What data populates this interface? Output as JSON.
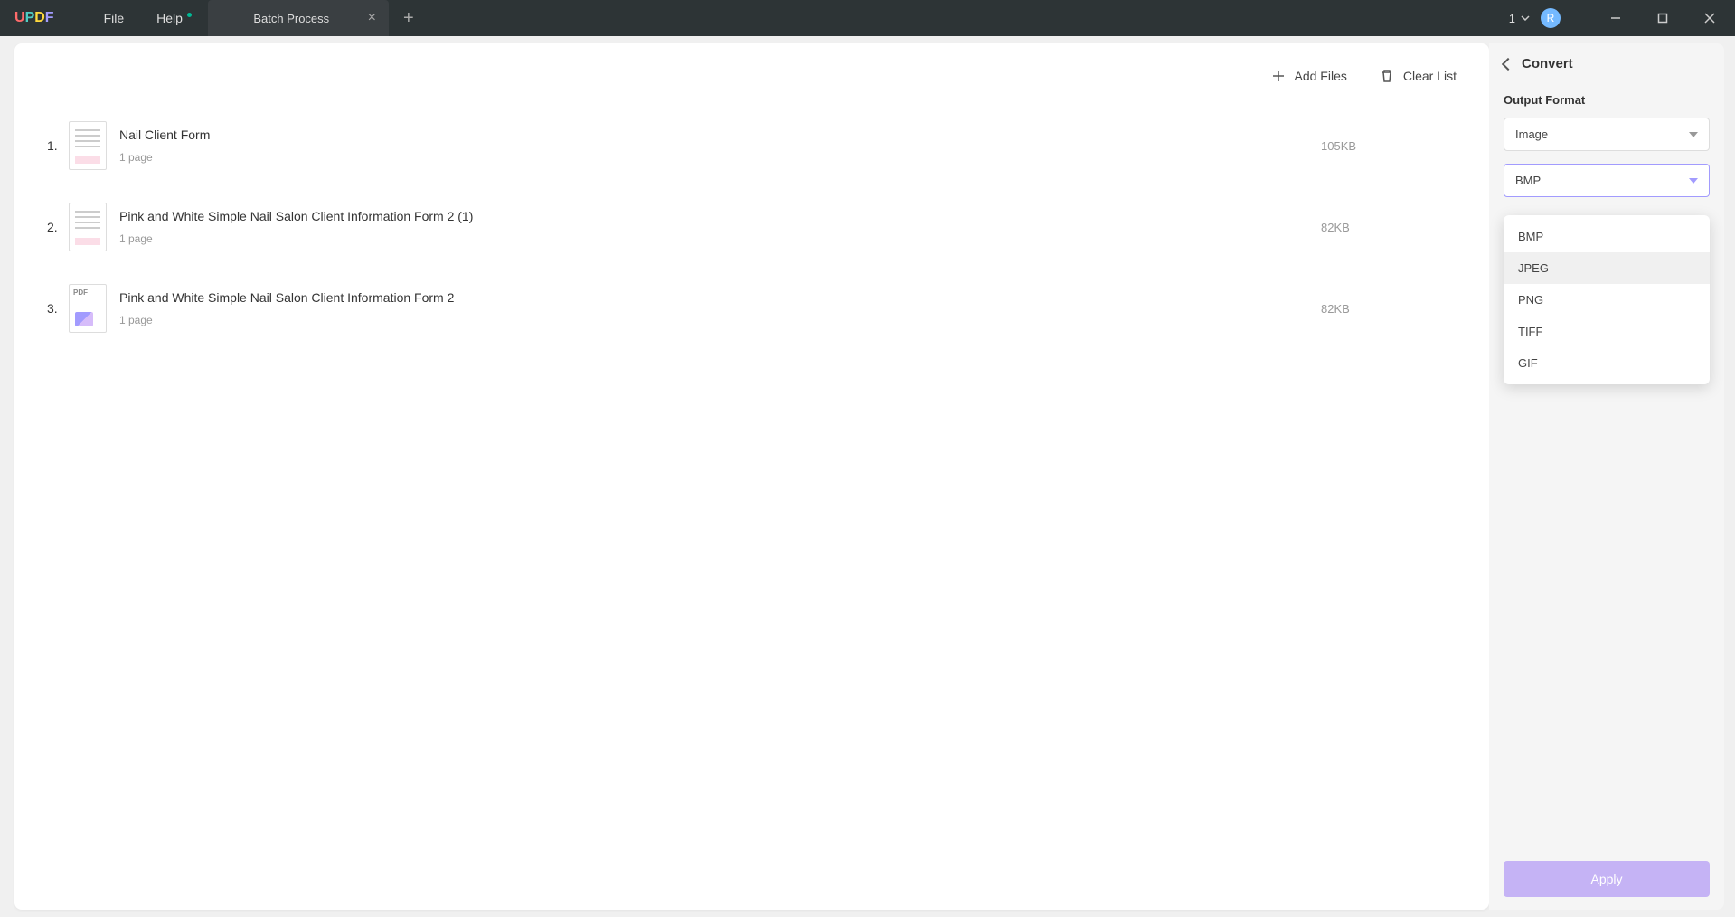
{
  "app": {
    "logo_u": "U",
    "logo_p": "P",
    "logo_d": "D",
    "logo_f": "F"
  },
  "menu": {
    "file": "File",
    "help": "Help"
  },
  "tab": {
    "title": "Batch Process"
  },
  "titlebar": {
    "count": "1",
    "avatar_letter": "R"
  },
  "toolbar": {
    "add_files": "Add Files",
    "clear_list": "Clear List"
  },
  "files": [
    {
      "index": "1.",
      "name": "Nail Client Form",
      "pages": "1 page",
      "size": "105KB",
      "thumb": "form"
    },
    {
      "index": "2.",
      "name": "Pink and White Simple Nail Salon Client Information Form 2 (1)",
      "pages": "1 page",
      "size": "82KB",
      "thumb": "form"
    },
    {
      "index": "3.",
      "name": "Pink and White Simple Nail Salon Client Information Form 2",
      "pages": "1 page",
      "size": "82KB",
      "thumb": "pdf",
      "pdf_label": "PDF"
    }
  ],
  "side": {
    "title": "Convert",
    "output_format_label": "Output Format",
    "format_select": "Image",
    "subformat_select": "BMP",
    "options": [
      "BMP",
      "JPEG",
      "PNG",
      "TIFF",
      "GIF"
    ],
    "apply": "Apply"
  }
}
